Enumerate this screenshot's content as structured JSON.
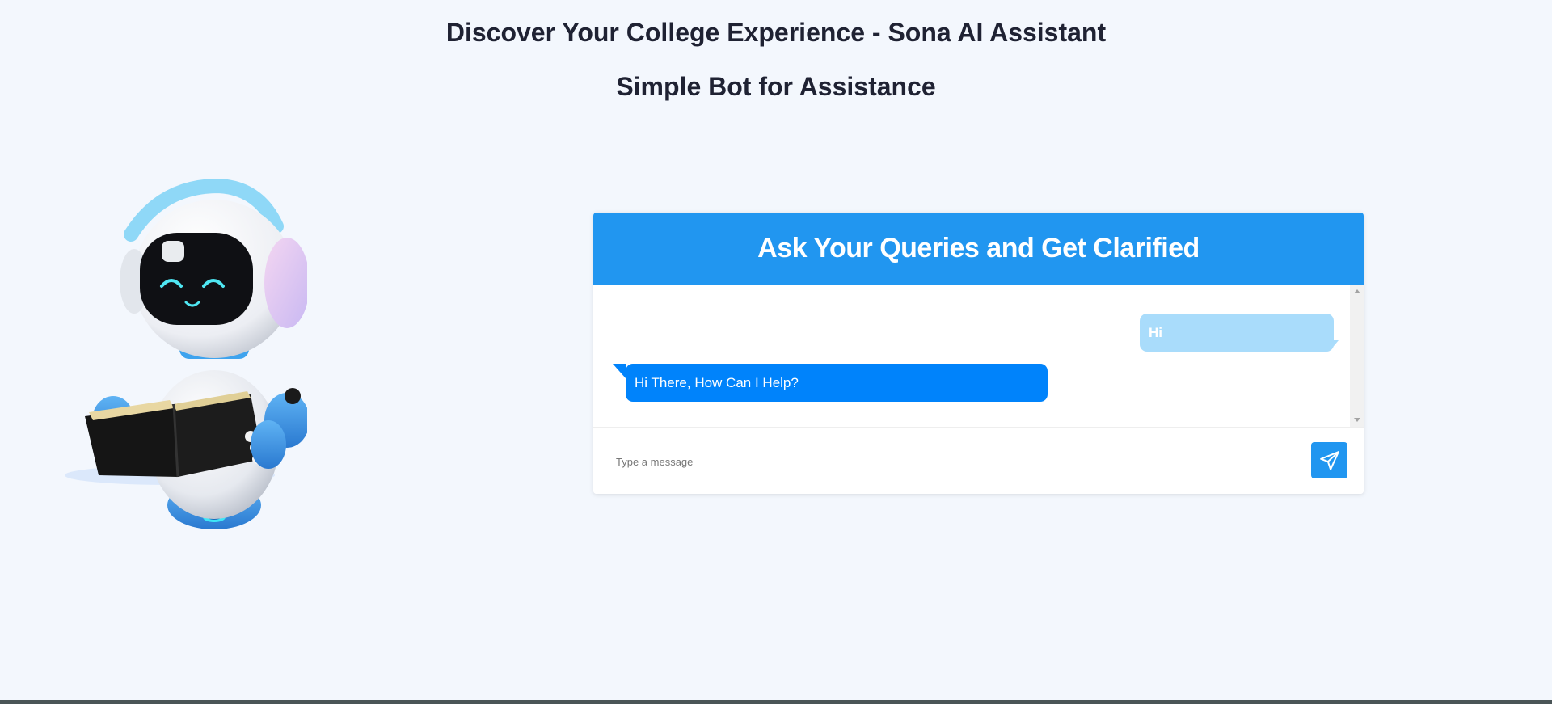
{
  "page": {
    "title": "Discover Your College Experience - Sona AI Assistant",
    "subtitle": "Simple Bot for Assistance"
  },
  "chat": {
    "header": "Ask Your Queries and Get Clarified",
    "messages": [
      {
        "sender": "user",
        "text": "Hi"
      },
      {
        "sender": "bot",
        "text": "Hi There, How Can I Help?"
      }
    ],
    "input_placeholder": "Type a message",
    "input_value": ""
  },
  "colors": {
    "background": "#f3f7fd",
    "accent": "#2196f0",
    "bot_bubble": "#0083fb",
    "user_bubble": "#a9dcfb"
  },
  "icons": {
    "send": "paper-plane-icon",
    "robot": "robot-reading-book-illustration"
  }
}
